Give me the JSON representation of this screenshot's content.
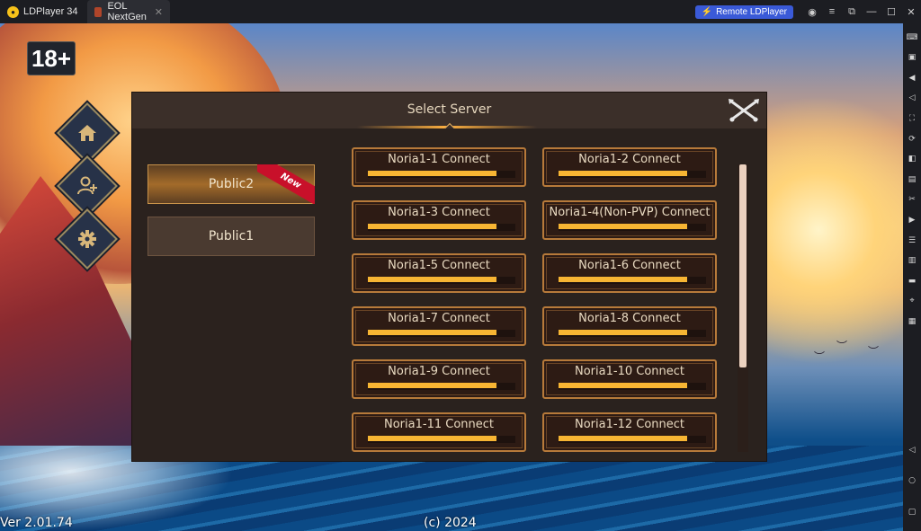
{
  "titlebar": {
    "app_tab": "LDPlayer 34",
    "game_tab": "EOL NextGen",
    "remote_button": "Remote LDPlayer"
  },
  "game": {
    "age_rating": "18+",
    "menu": [
      {
        "icon": "home-icon"
      },
      {
        "icon": "add-friend-icon"
      },
      {
        "icon": "gear-icon"
      }
    ],
    "version": "Ver 2.01.74",
    "copyright": "(c) 2024"
  },
  "dialog": {
    "title": "Select Server",
    "groups": [
      {
        "label": "Public2",
        "badge": "New",
        "active": true
      },
      {
        "label": "Public1",
        "badge": "",
        "active": false
      }
    ],
    "servers": [
      {
        "label": "Noria1-1 Connect",
        "load": 0.87
      },
      {
        "label": "Noria1-2 Connect",
        "load": 0.87
      },
      {
        "label": "Noria1-3 Connect",
        "load": 0.87
      },
      {
        "label": "Noria1-4(Non-PVP) Connect",
        "load": 0.87
      },
      {
        "label": "Noria1-5 Connect",
        "load": 0.87
      },
      {
        "label": "Noria1-6 Connect",
        "load": 0.87
      },
      {
        "label": "Noria1-7 Connect",
        "load": 0.87
      },
      {
        "label": "Noria1-8 Connect",
        "load": 0.87
      },
      {
        "label": "Noria1-9 Connect",
        "load": 0.87
      },
      {
        "label": "Noria1-10 Connect",
        "load": 0.87
      },
      {
        "label": "Noria1-11 Connect",
        "load": 0.87
      },
      {
        "label": "Noria1-12 Connect",
        "load": 0.87
      }
    ]
  },
  "colors": {
    "bar_fill": "#f7b533",
    "button_border": "#b77a3a",
    "new_ribbon": "#c8102a",
    "remote_button": "#3a5ad8"
  }
}
